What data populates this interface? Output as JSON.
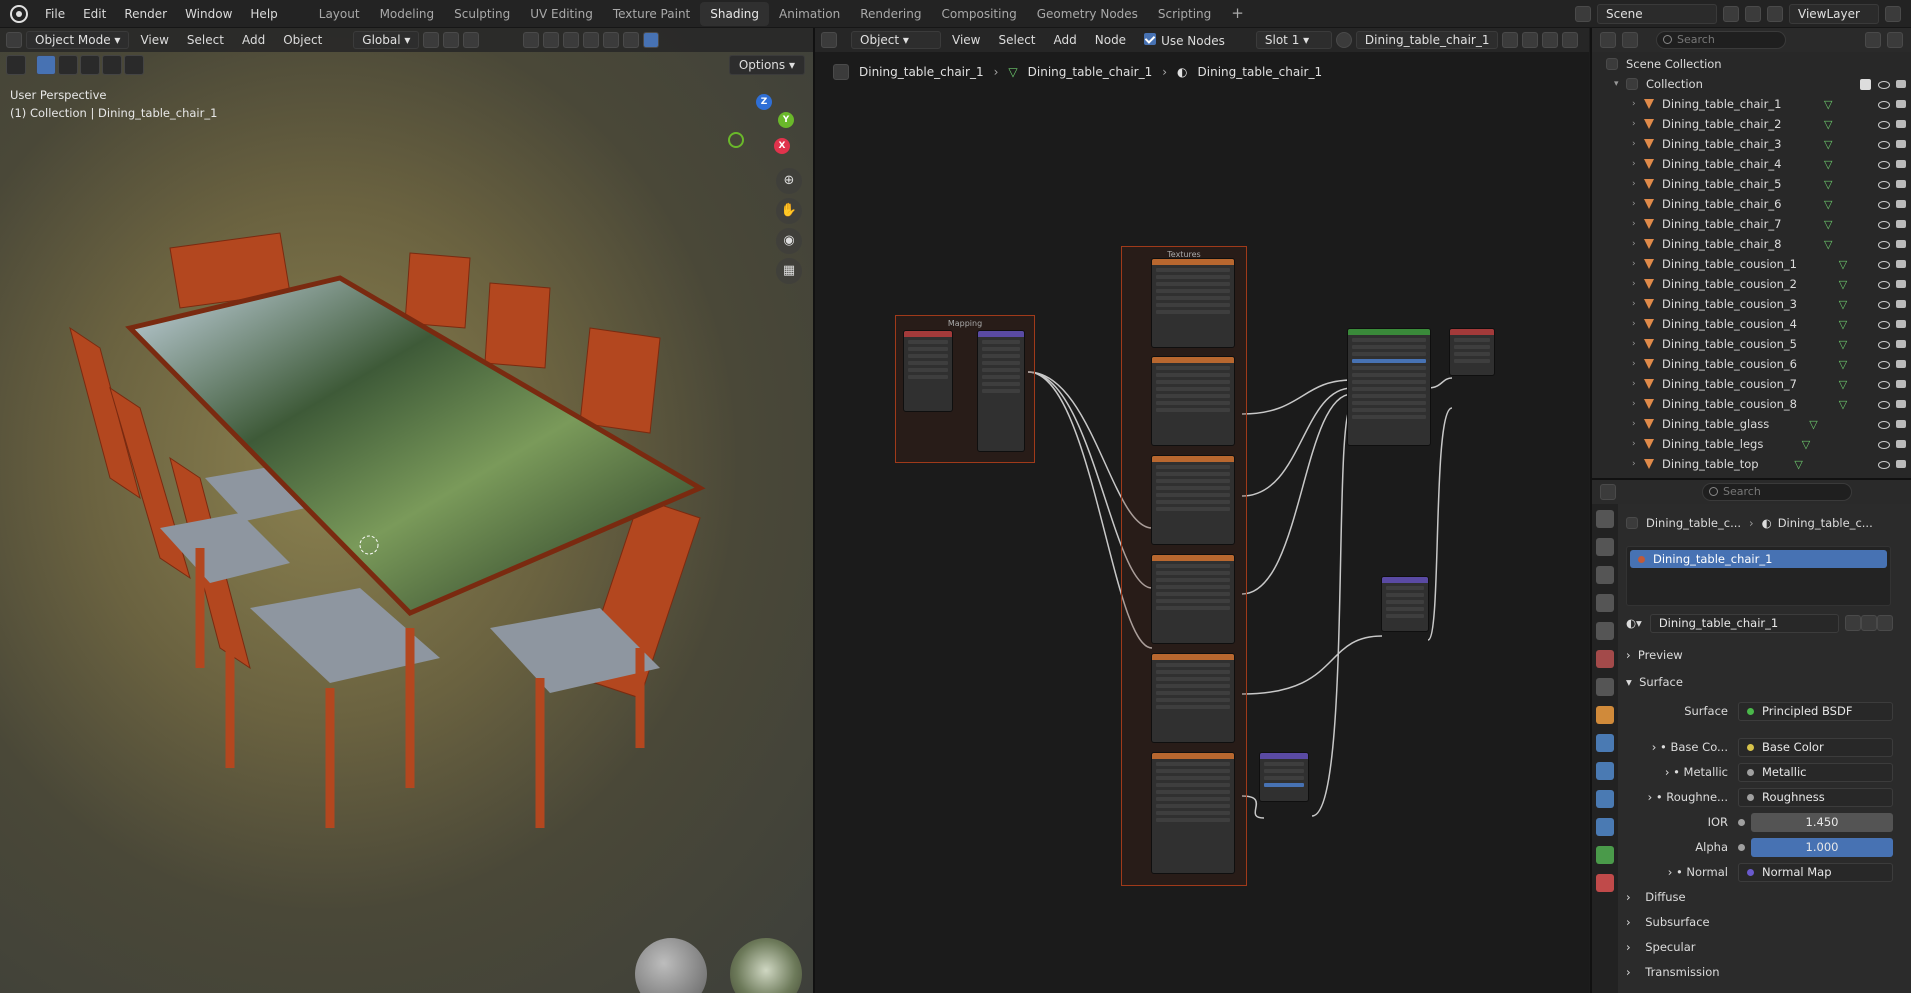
{
  "menus": [
    "File",
    "Edit",
    "Render",
    "Window",
    "Help"
  ],
  "workspaces": [
    "Layout",
    "Modeling",
    "Sculpting",
    "UV Editing",
    "Texture Paint",
    "Shading",
    "Animation",
    "Rendering",
    "Compositing",
    "Geometry Nodes",
    "Scripting"
  ],
  "active_workspace": "Shading",
  "scene": "Scene",
  "view_layer": "ViewLayer",
  "viewport": {
    "mode": "Object Mode",
    "menu": [
      "View",
      "Select",
      "Add",
      "Object"
    ],
    "orientation": "Global",
    "options": "Options",
    "perspective": "User Perspective",
    "active": "(1) Collection | Dining_table_chair_1"
  },
  "node_editor": {
    "type": "Object",
    "menu": [
      "View",
      "Select",
      "Add",
      "Node"
    ],
    "use_nodes": "Use Nodes",
    "slot": "Slot 1",
    "material": "Dining_table_chair_1",
    "breadcrumbs": [
      "Dining_table_chair_1",
      "Dining_table_chair_1",
      "Dining_table_chair_1"
    ],
    "frame_mapping": "Mapping",
    "frame_textures": "Textures"
  },
  "outliner": {
    "search": "Search",
    "scene_collection": "Scene Collection",
    "collection": "Collection",
    "items": [
      "Dining_table_chair_1",
      "Dining_table_chair_2",
      "Dining_table_chair_3",
      "Dining_table_chair_4",
      "Dining_table_chair_5",
      "Dining_table_chair_6",
      "Dining_table_chair_7",
      "Dining_table_chair_8",
      "Dining_table_cousion_1",
      "Dining_table_cousion_2",
      "Dining_table_cousion_3",
      "Dining_table_cousion_4",
      "Dining_table_cousion_5",
      "Dining_table_cousion_6",
      "Dining_table_cousion_7",
      "Dining_table_cousion_8",
      "Dining_table_glass",
      "Dining_table_legs",
      "Dining_table_top"
    ]
  },
  "properties": {
    "search": "Search",
    "crumb1": "Dining_table_c...",
    "crumb2": "Dining_table_c...",
    "slot_item": "Dining_table_chair_1",
    "material": "Dining_table_chair_1",
    "preview": "Preview",
    "surface_header": "Surface",
    "surface_label": "Surface",
    "surface_value": "Principled BSDF",
    "rows": [
      {
        "label": "Base Co...",
        "value": "Base Color"
      },
      {
        "label": "Metallic",
        "value": "Metallic"
      },
      {
        "label": "Roughne...",
        "value": "Roughness"
      }
    ],
    "ior_label": "IOR",
    "ior_value": "1.450",
    "alpha_label": "Alpha",
    "alpha_value": "1.000",
    "normal_label": "Normal",
    "normal_value": "Normal Map",
    "sections": [
      "Diffuse",
      "Subsurface",
      "Specular",
      "Transmission"
    ]
  }
}
